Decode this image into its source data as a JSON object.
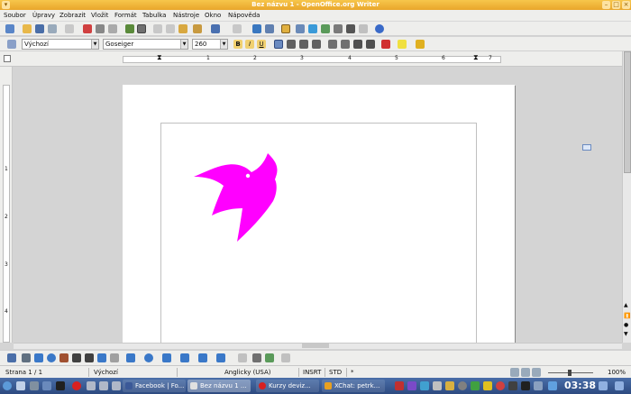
{
  "window": {
    "title": "Bez názvu 1 - OpenOffice.org Writer"
  },
  "menu": [
    "Soubor",
    "Úpravy",
    "Zobrazit",
    "Vložit",
    "Formát",
    "Tabulka",
    "Nástroje",
    "Okno",
    "Nápověda"
  ],
  "format_bar": {
    "style": "Výchozí",
    "font": "Goseiger",
    "size": "260",
    "bold": "B",
    "italic": "I",
    "underline": "U"
  },
  "ruler": {
    "marks": [
      "1",
      "2",
      "3",
      "4",
      "5",
      "6",
      "7"
    ]
  },
  "vruler": {
    "marks": [
      "1",
      "2",
      "3",
      "4"
    ]
  },
  "status": {
    "page": "Strana 1 / 1",
    "style": "Výchozí",
    "language": "Anglicky (USA)",
    "insert": "INSRT",
    "selection": "STD",
    "modified": "*",
    "zoom": "100%"
  },
  "taskbar": {
    "tasks": [
      "Facebook | Fo...",
      "Bez názvu 1 ...",
      "Kurzy deviz...",
      "XChat: petrk..."
    ],
    "clock": "03:38"
  },
  "colors": {
    "logo": "#ff00ff",
    "titlebar": "#f2b93b",
    "taskbar": "#3a5c96"
  }
}
